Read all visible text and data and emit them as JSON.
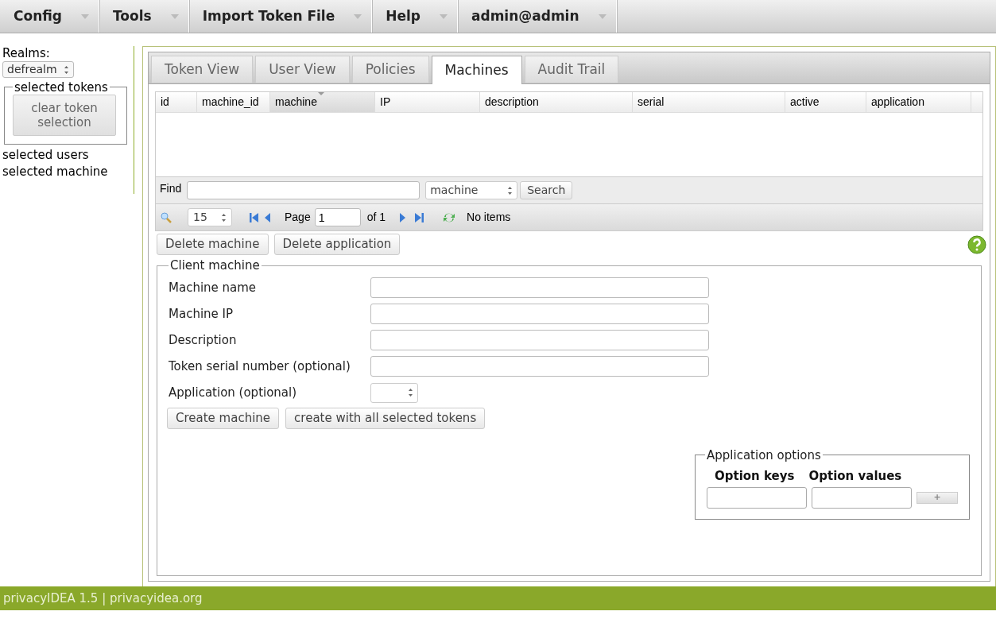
{
  "menu": [
    {
      "label": "Config"
    },
    {
      "label": "Tools"
    },
    {
      "label": "Import Token File"
    },
    {
      "label": "Help"
    },
    {
      "label": "admin@admin"
    }
  ],
  "sidebar": {
    "realms_label": "Realms:",
    "realm_select": "defrealm",
    "selected_tokens_legend": "selected tokens",
    "clear_button": "clear token selection",
    "selected_users": "selected users",
    "selected_machine": "selected machine"
  },
  "tabs": [
    {
      "label": "Token View",
      "selected": false
    },
    {
      "label": "User View",
      "selected": false
    },
    {
      "label": "Policies",
      "selected": false
    },
    {
      "label": "Machines",
      "selected": true
    },
    {
      "label": "Audit Trail",
      "selected": false
    }
  ],
  "table": {
    "columns": [
      {
        "label": "id",
        "sorted": false
      },
      {
        "label": "machine_id",
        "sorted": false
      },
      {
        "label": "machine",
        "sorted": true
      },
      {
        "label": "IP",
        "sorted": false
      },
      {
        "label": "description",
        "sorted": false
      },
      {
        "label": "serial",
        "sorted": false
      },
      {
        "label": "active",
        "sorted": false
      },
      {
        "label": "application",
        "sorted": false
      }
    ]
  },
  "find": {
    "label": "Find",
    "field_select": "machine",
    "button": "Search"
  },
  "pager": {
    "page_size": "15",
    "page_label": "Page",
    "page": "1",
    "of": "of 1",
    "status": "No items"
  },
  "actions": [
    "Delete machine",
    "Delete application"
  ],
  "client_machine": {
    "legend": "Client machine",
    "fields": [
      {
        "label": "Machine name",
        "kind": "text"
      },
      {
        "label": "Machine IP",
        "kind": "text"
      },
      {
        "label": "Description",
        "kind": "text"
      },
      {
        "label": "Token serial number (optional)",
        "kind": "text"
      },
      {
        "label": "Application (optional)",
        "kind": "select"
      }
    ],
    "buttons": [
      "Create machine",
      "create with all selected tokens"
    ],
    "app_options": {
      "legend": "Application options",
      "key_header": "Option keys",
      "value_header": "Option values",
      "add_button": "+"
    }
  },
  "footer": "privacyIDEA 1.5 | privacyidea.org"
}
